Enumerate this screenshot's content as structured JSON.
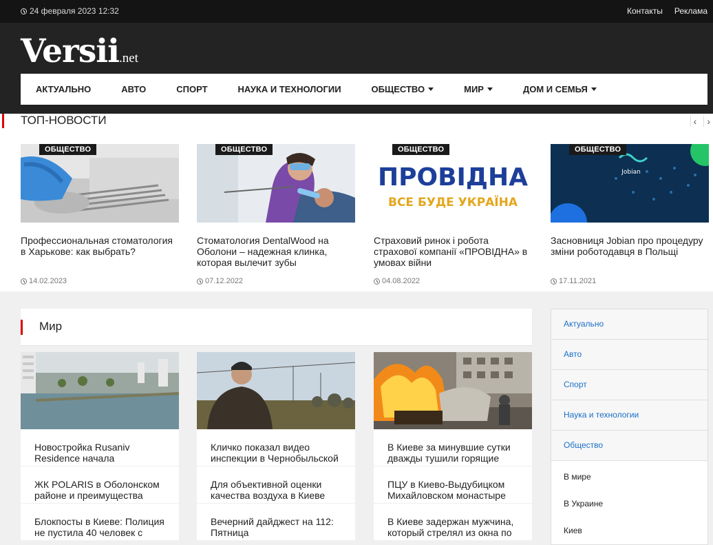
{
  "topbar": {
    "date": "24 февраля 2023 12:32",
    "links": [
      "Контакты",
      "Реклама"
    ]
  },
  "logo": {
    "main": "Versii",
    "tld": ".net"
  },
  "nav": [
    {
      "label": "АКТУАЛЬНО",
      "dropdown": false
    },
    {
      "label": "АВТО",
      "dropdown": false
    },
    {
      "label": "СПОРТ",
      "dropdown": false
    },
    {
      "label": "НАУКА И ТЕХНОЛОГИИ",
      "dropdown": false
    },
    {
      "label": "ОБЩЕСТВО",
      "dropdown": true
    },
    {
      "label": "МИР",
      "dropdown": true
    },
    {
      "label": "ДОМ И СЕМЬЯ",
      "dropdown": true
    }
  ],
  "top_news": {
    "title": "ТОП-НОВОСТИ",
    "arrows": [
      "‹",
      "›"
    ],
    "cards": [
      {
        "badge": "ОБЩЕСТВО",
        "headline": "Профессиональная стоматология в Харькове: как выбрать?",
        "date": "14.02.2023"
      },
      {
        "badge": "ОБЩЕСТВО",
        "headline": "Стоматология DentalWood на Оболони – надежная клинка, которая вылечит зубы",
        "date": "07.12.2022"
      },
      {
        "badge": "ОБЩЕСТВО",
        "headline": "Страховий ринок і робота страхової компанії «ПРОВІДНА» в умовах війни",
        "date": "04.08.2022",
        "image_text": [
          "ПРОВІДНА",
          "ВСЕ БУДЕ УКРАЇНА"
        ]
      },
      {
        "badge": "ОБЩЕСТВО",
        "headline": "Засновниця Jobian про процедуру зміни роботодавця в Польщі",
        "date": "17.11.2021",
        "image_text": [
          "Jobian"
        ]
      }
    ]
  },
  "section": {
    "label": "Мир",
    "columns": [
      {
        "stories": [
          "Новостройка Rusaniv Residence начала возводится в ...",
          "ЖК POLARIS в Оболонском районе и преимущества",
          "Блокпосты в Киеве: Полиция не пустила 40 человек с"
        ]
      },
      {
        "stories": [
          "Кличко показал видео инспекции в Чернобыльской",
          "Для объективной оценки качества воздуха в Киеве",
          "Вечерний дайджест на 112: Пятница"
        ]
      },
      {
        "stories": [
          "В Киеве за минувшие сутки дважды тушили горящие",
          "ПЦУ в Киево-Выдубицком Михайловском монастыре",
          "В Киеве задержан мужчина, который стрелял из окна по"
        ]
      }
    ]
  },
  "sidebar": {
    "categories": [
      "Актуально",
      "Авто",
      "Спорт",
      "Наука и технологии",
      "Общество"
    ],
    "subitems": [
      "В мире",
      "В Украине",
      "Киев"
    ]
  },
  "colors": {
    "accent_red": "#dd0000",
    "link_blue": "#1a6fc9",
    "dark_bg": "#232323",
    "topbar_bg": "#141414"
  }
}
